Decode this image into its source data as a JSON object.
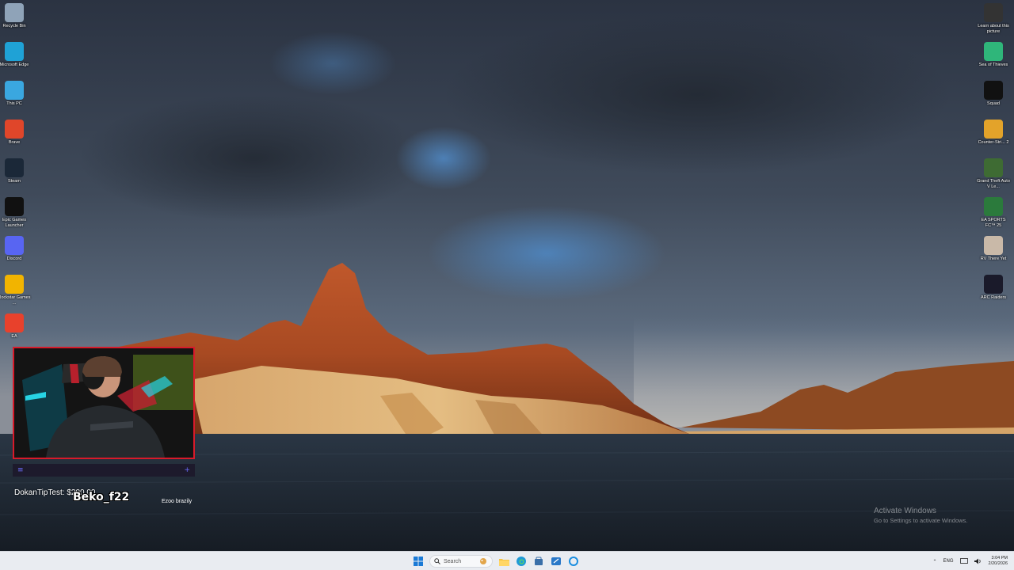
{
  "desktop_left": [
    {
      "label": "Recycle Bin",
      "icon": "recycle-bin-icon",
      "color": "#8fa3b8"
    },
    {
      "label": "Microsoft Edge",
      "icon": "edge-icon",
      "color": "#1fa2d6"
    },
    {
      "label": "This PC",
      "icon": "monitor-icon",
      "color": "#3aa7e0"
    },
    {
      "label": "Brave",
      "icon": "brave-icon",
      "color": "#e0462a"
    },
    {
      "label": "Steam",
      "icon": "steam-icon",
      "color": "#1b2838"
    },
    {
      "label": "Epic Games Launcher",
      "icon": "epic-games-icon",
      "color": "#111111"
    },
    {
      "label": "Discord",
      "icon": "discord-icon",
      "color": "#5865f2"
    },
    {
      "label": "Rockstar Games ...",
      "icon": "rockstar-icon",
      "color": "#f2b400"
    },
    {
      "label": "EA",
      "icon": "ea-icon",
      "color": "#e8412c"
    }
  ],
  "desktop_right": [
    {
      "label": "Learn about this picture",
      "icon": "camera-info-icon",
      "color": "#333333"
    },
    {
      "label": "Sea of Thieves",
      "icon": "sea-of-thieves-icon",
      "color": "#2fb67a"
    },
    {
      "label": "Squad",
      "icon": "squad-icon",
      "color": "#111111"
    },
    {
      "label": "Counter-Stri... 2",
      "icon": "counter-strike-icon",
      "color": "#e3a32a"
    },
    {
      "label": "Grand Theft Auto V Le...",
      "icon": "gta-icon",
      "color": "#3e6b33"
    },
    {
      "label": "EA SPORTS FC™ 25",
      "icon": "ea-sports-fc-icon",
      "color": "#2b7a3c"
    },
    {
      "label": "RV There Yet",
      "icon": "rv-there-yet-icon",
      "color": "#c9b9a8"
    },
    {
      "label": "ARC Raiders",
      "icon": "arc-raiders-icon",
      "color": "#1a1a2a"
    }
  ],
  "overlay": {
    "tip_text": "DokanTipTest: $200.00",
    "streamer_name": "Beko_f22",
    "small_text": "Ezoo brazily"
  },
  "watermark": {
    "line1": "Activate Windows",
    "line2": "Go to Settings to activate Windows."
  },
  "taskbar": {
    "search_placeholder": "Search",
    "language": "ENG",
    "time": "3:04 PM",
    "date": "2/20/2026"
  }
}
